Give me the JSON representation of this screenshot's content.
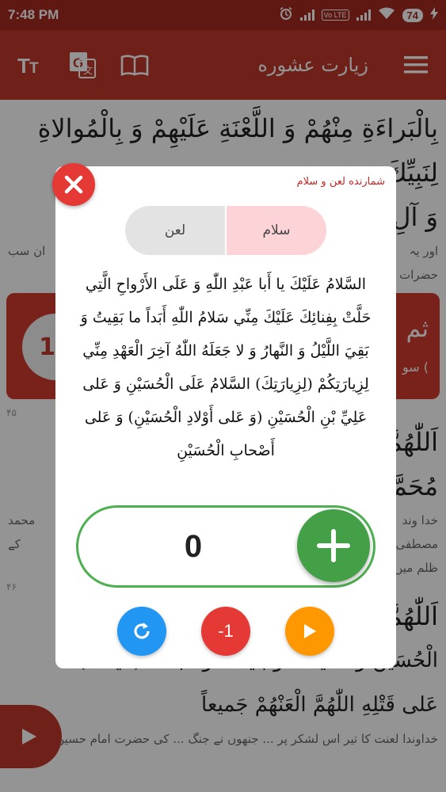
{
  "status": {
    "time": "7:48 PM",
    "network": "Vo LTE",
    "battery": "74"
  },
  "toolbar": {
    "title": "زيارت عشوره",
    "font_icon": "text-size-icon",
    "translate_icon": "translate-icon",
    "book_icon": "book-icon",
    "menu_icon": "menu-icon"
  },
  "background": {
    "arabic_line_1": "بِالْبَراءَةِ مِنْهُمْ وَ اللَّعْنَةِ عَلَيْهِمْ وَ بِالْمُوالاةِ لِنَبِيِّكَ",
    "arabic_line_2": "وَ آلِ",
    "urdu_line": "اور یہ",
    "urdu_line_b": "ان سب",
    "urdu_line_2": "حضرات",
    "card_text": "ثم",
    "card_sub": "سو (",
    "card_count": "10",
    "verse_45": "۴۵",
    "arabic_line_3": "اَللّٰهُمَّ",
    "arabic_line_4": "مُحَمَّ",
    "urdu_line_3": "خدا وند",
    "urdu_line_3b": "محمد",
    "urdu_line_4": "مصطفی",
    "urdu_line_4b": "کے",
    "urdu_line_5": "ظلم میں",
    "verse_46": "۴۶",
    "arabic_line_5": "اَللّٰهُمَّ",
    "arabic_line_6": "الْحُسَيْنَ وَ شايَعَتْ وَ بايَعَتْ وَ تابَعَتْ (تايَعَتْ)",
    "arabic_line_7": "عَلى قَتْلِهِ اللّٰهُمَّ الْعَنْهُمْ جَميعاً",
    "urdu_line_6": "خداوندا لعنت کا تیر اس لشکر پر ... جنھوں نے جنگ ... کی حضرت امام حسین"
  },
  "dialog": {
    "title": "شمارنده لعن و سلام",
    "tabs": [
      "لعن",
      "سلام"
    ],
    "selected_tab": "سلام",
    "prayer": "السَّلامُ عَلَيْكَ يا أَبا عَبْدِ اللّٰهِ وَ عَلَى الأَرْواحِ الَّتِي حَلَّتْ بِفِنائِكَ عَلَيْكَ مِنِّي سَلامُ اللّٰهِ أَبَداً ما بَقِيتُ وَ بَقِيَ اللَّيْلُ وَ النَّهارُ وَ لا جَعَلَهُ اللّٰهُ آخِرَ الْعَهْدِ مِنِّي لِزِيارَتِكُمْ (لِزِيارَتِكَ) السَّلامُ عَلَى الْحُسَيْنِ وَ عَلى عَلِيِّ بْنِ الْحُسَيْنِ (وَ عَلى أَوْلادِ الْحُسَيْنِ) وَ عَلى أَصْحابِ الْحُسَيْنِ",
    "counter_value": "0",
    "minus_label": "-1",
    "colors": {
      "plus": "#43a047",
      "reset": "#2196f3",
      "minus": "#e53935",
      "play": "#ff9800"
    }
  }
}
